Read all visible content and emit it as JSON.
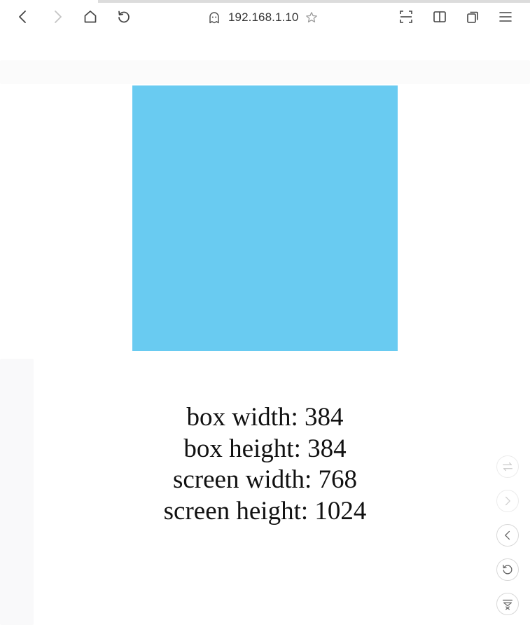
{
  "browser": {
    "url": "192.168.1.10",
    "load_progress": 0.82,
    "icons": {
      "back": "back-arrow-icon",
      "forward": "forward-arrow-icon",
      "home": "home-icon",
      "reload": "reload-icon",
      "privacy": "ghost-icon",
      "bookmark": "star-icon",
      "scan": "scan-icon",
      "reader": "book-icon",
      "tabs": "tabs-icon",
      "menu": "menu-icon"
    }
  },
  "page": {
    "box_color": "#69cbf1",
    "lines": {
      "box_width": "box width: 384",
      "box_height": "box height: 384",
      "screen_width": "screen width: 768",
      "screen_height": "screen height: 1024"
    }
  },
  "side_controls": {
    "icons": [
      "swap-icon",
      "forward-icon",
      "back-icon",
      "refresh-icon",
      "collapse-toolbar-icon"
    ]
  }
}
